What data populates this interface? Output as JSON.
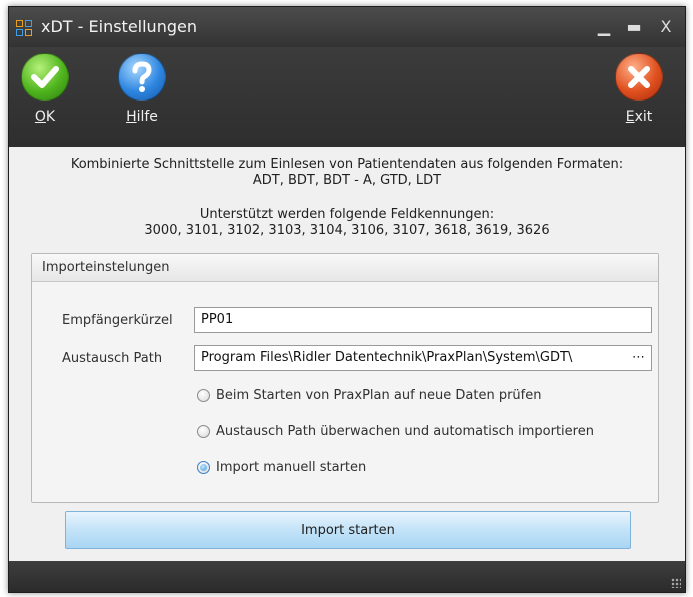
{
  "window": {
    "title": "xDT - Einstellungen",
    "minimize_glyph": "▁",
    "maximize_glyph": "▬",
    "close_glyph": "X"
  },
  "toolbar": {
    "ok": {
      "underline": "O",
      "rest": "K",
      "icon": "checkmark-icon",
      "color": "#4fb51e"
    },
    "help": {
      "underline": "H",
      "rest": "ilfe",
      "icon": "question-mark-icon",
      "color": "#2e86e0"
    },
    "exit": {
      "underline": "E",
      "rest": "xit",
      "icon": "close-x-icon",
      "color": "#e0501e"
    }
  },
  "info": {
    "line1": "Kombinierte Schnittstelle zum Einlesen von Patientendaten aus folgenden Formaten:",
    "line2": "ADT, BDT, BDT - A, GTD, LDT",
    "line3": "Unterstützt werden folgende Feldkennungen:",
    "line4": "3000, 3101, 3102, 3103, 3104, 3106, 3107, 3618, 3619, 3626"
  },
  "import_settings": {
    "header": "Importeinstelungen",
    "empfaenger_label": "Empfängerkürzel",
    "empfaenger_value": "PP01",
    "path_label": "Austausch Path",
    "path_value": "Program Files\\Ridler Datentechnik\\PraxPlan\\System\\GDT\\",
    "browse_glyph": "⋯",
    "options": [
      {
        "label": "Beim Starten von PraxPlan auf neue Daten prüfen",
        "checked": false
      },
      {
        "label": "Austausch Path überwachen und automatisch importieren",
        "checked": false
      },
      {
        "label": "Import manuell starten",
        "checked": true
      }
    ]
  },
  "import_button": "Import starten"
}
